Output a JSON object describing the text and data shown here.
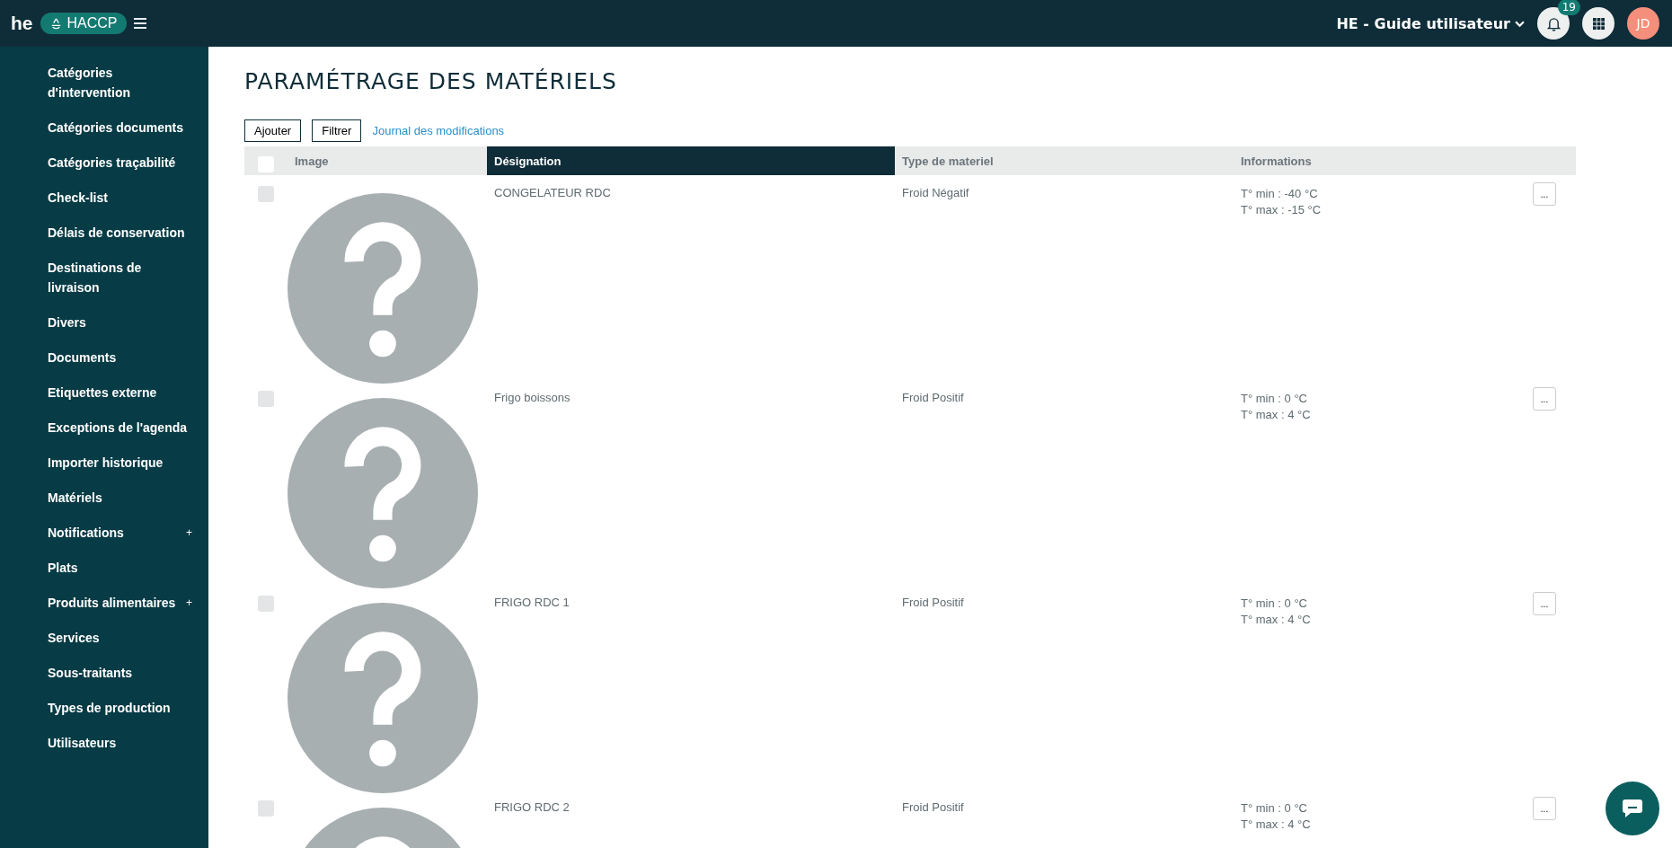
{
  "header": {
    "logo_text": "he",
    "app_badge": "HACCP",
    "site": "HE - Guide utilisateur",
    "notifications_count": "19",
    "avatar_initials": "JD"
  },
  "sidebar": {
    "items": [
      {
        "label": "Catégories d'intervention"
      },
      {
        "label": "Catégories documents"
      },
      {
        "label": "Catégories traçabilité"
      },
      {
        "label": "Check-list"
      },
      {
        "label": "Délais de conservation"
      },
      {
        "label": "Destinations de livraison"
      },
      {
        "label": "Divers"
      },
      {
        "label": "Documents"
      },
      {
        "label": "Etiquettes externe"
      },
      {
        "label": "Exceptions de l'agenda"
      },
      {
        "label": "Importer historique"
      },
      {
        "label": "Matériels"
      },
      {
        "label": "Notifications",
        "toggle": "+"
      },
      {
        "label": "Plats"
      },
      {
        "label": "Produits alimentaires",
        "toggle": "+"
      },
      {
        "label": "Services"
      },
      {
        "label": "Sous-traitants"
      },
      {
        "label": "Types de production"
      },
      {
        "label": "Utilisateurs"
      }
    ]
  },
  "page": {
    "title": "PARAMÉTRAGE DES MATÉRIELS",
    "buttons": [
      "Ajouter",
      "Filtrer"
    ],
    "link": "Journal des modifications"
  },
  "table": {
    "select_all_checked": false,
    "columns": [
      {
        "label": "Image",
        "selected": false
      },
      {
        "label": "Désignation",
        "selected": true
      },
      {
        "label": "Type de materiel",
        "selected": false
      },
      {
        "label": "Informations",
        "selected": false
      }
    ],
    "rows": [
      {
        "checked": false,
        "designation": "CONGELATEUR RDC",
        "type": "Froid Négatif",
        "info": [
          "T° min : -40 °C",
          "T° max : -15 °C"
        ],
        "action": "..."
      },
      {
        "checked": false,
        "designation": "Frigo boissons",
        "type": "Froid Positif",
        "info": [
          "T° min : 0 °C",
          "T° max : 4 °C"
        ],
        "action": "..."
      },
      {
        "checked": false,
        "designation": "FRIGO RDC 1",
        "type": "Froid Positif",
        "info": [
          "T° min : 0 °C",
          "T° max : 4 °C"
        ],
        "action": "..."
      },
      {
        "checked": false,
        "designation": "FRIGO RDC 2",
        "type": "Froid Positif",
        "info": [
          "T° min : 0 °C",
          "T° max : 4 °C"
        ],
        "action": "..."
      }
    ]
  }
}
